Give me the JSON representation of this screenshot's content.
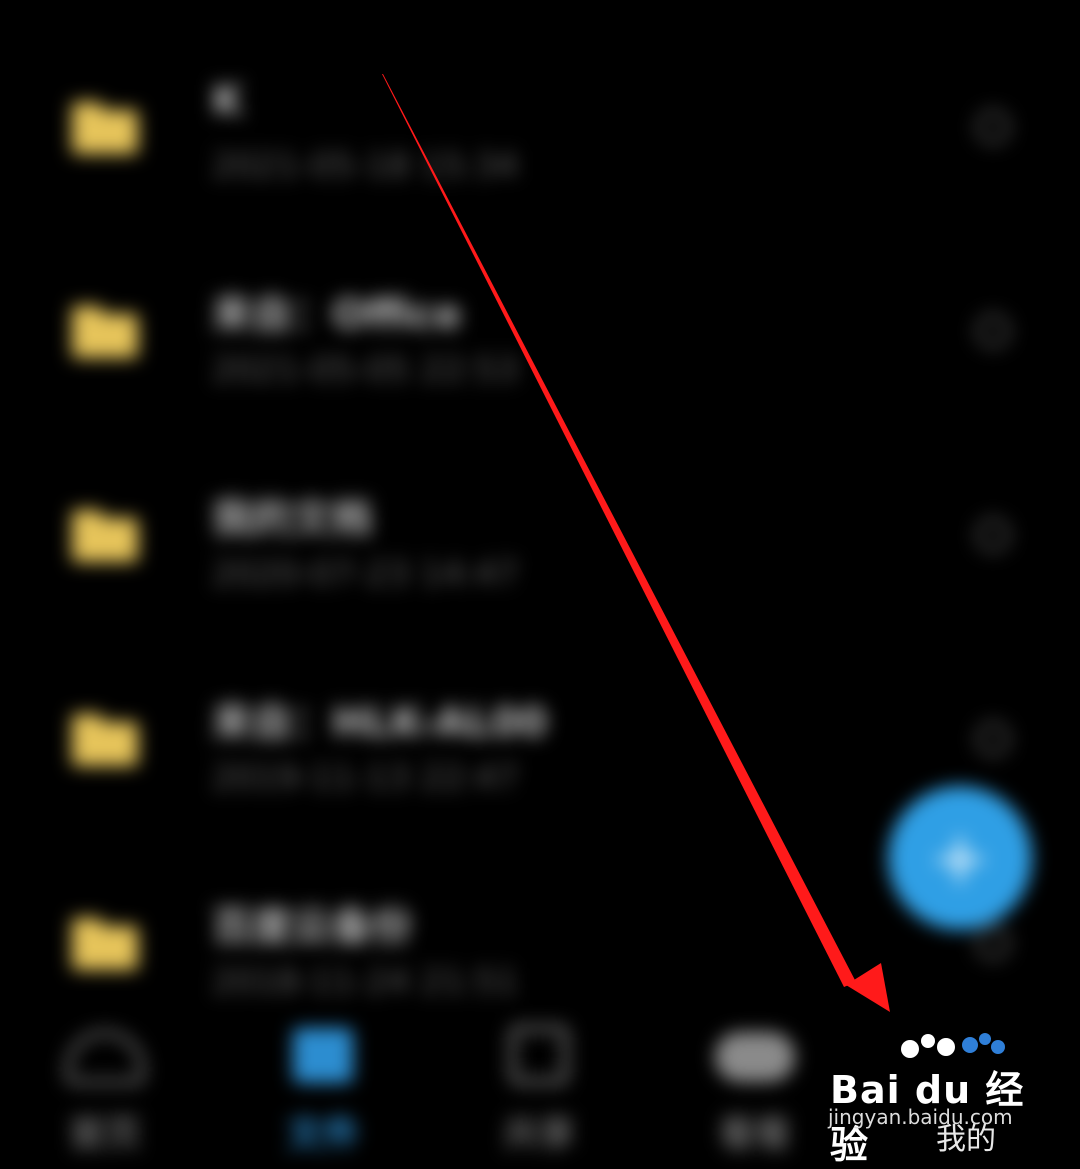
{
  "files": [
    {
      "title": "K",
      "date": "2021-05-18 15:34"
    },
    {
      "title": "来自：Office",
      "date": "2021-05-05 22:53"
    },
    {
      "title": "我的文档",
      "date": "2020-07-23 14:47"
    },
    {
      "title": "来自：HLK-AL00",
      "date": "2019-11-13 22:47"
    },
    {
      "title": "百度云备份",
      "date": "2018-11-24 21:51"
    }
  ],
  "fab": {
    "icon": "plus-icon",
    "symbol": "+"
  },
  "nav": [
    {
      "label": "首页",
      "icon": "cloud-icon"
    },
    {
      "label": "文件",
      "icon": "folder-icon",
      "active": true
    },
    {
      "label": "共享",
      "icon": "share-icon"
    },
    {
      "label": "看看",
      "icon": "disc-icon"
    },
    {
      "label": "我的",
      "icon": "user-icon"
    }
  ],
  "watermark": {
    "logo": "Bai du 经验",
    "url": "jingyan.baidu.com"
  },
  "colors": {
    "background": "#000000",
    "folder": "#e6c45a",
    "accent": "#2f9fe5",
    "arrow": "#ff1a1a"
  }
}
